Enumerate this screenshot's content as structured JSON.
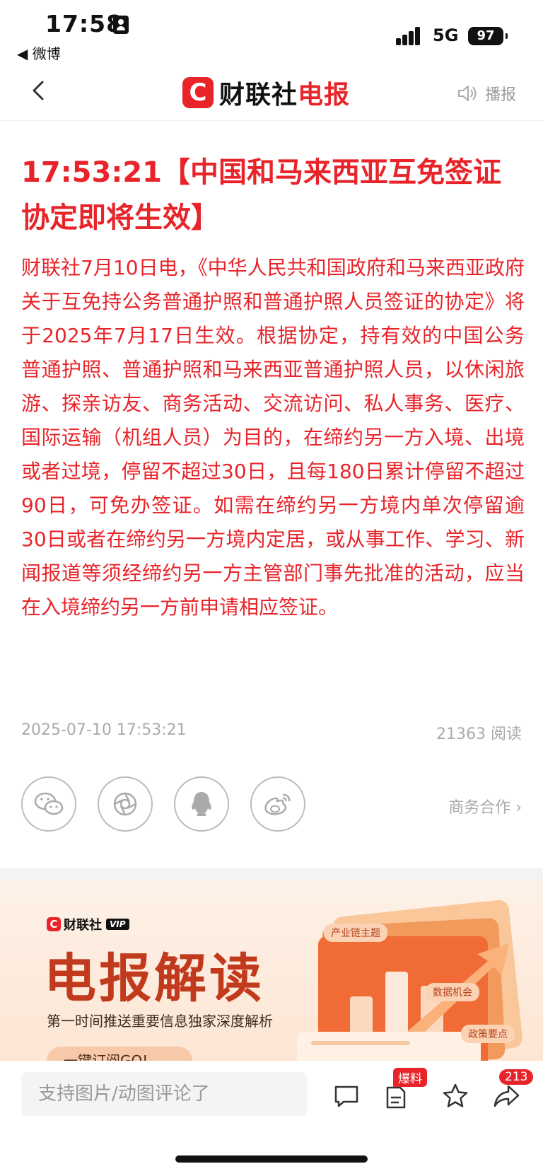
{
  "status_bar": {
    "time": "17:58",
    "back_app": "◀ 微博",
    "network": "5G",
    "battery": "97"
  },
  "nav": {
    "logo_mark": "C",
    "logo_brand": "财联社",
    "logo_product": "电报",
    "broadcast_label": "播报"
  },
  "article": {
    "headline": "17:53:21【中国和马来西亚互免签证协定即将生效】",
    "body": "财联社7月10日电，《中华人民共和国政府和马来西亚政府关于互免持公务普通护照和普通护照人员签证的协定》将于2025年7月17日生效。根据协定，持有效的中国公务普通护照、普通护照和马来西亚普通护照人员，以休闲旅游、探亲访友、商务活动、交流访问、私人事务、医疗、国际运输（机组人员）为目的，在缔约另一方入境、出境或者过境，停留不超过30日，且每180日累计停留不超过90日，可免办签证。如需在缔约另一方境内单次停留逾30日或者在缔约另一方境内定居，或从事工作、学习、新闻报道等须经缔约另一方主管部门事先批准的活动，应当在入境缔约另一方前申请相应签证。",
    "datetime": "2025-07-10 17:53:21",
    "reads": "21363 阅读"
  },
  "share": {
    "icons": [
      "wechat-icon",
      "moments-icon",
      "qq-icon",
      "weibo-icon"
    ],
    "business_link": "商务合作 ›"
  },
  "banner": {
    "vip_logo_mark": "C",
    "vip_brand": "财联社",
    "vip_tag": "VIP",
    "title": "电报解读",
    "subtitle": "第一时间推送重要信息独家深度解析",
    "button": "一键订阅GO!",
    "chips": [
      "产业链主题",
      "数据机会",
      "政策要点"
    ]
  },
  "bottom_bar": {
    "comment_placeholder": "支持图片/动图评论了",
    "report_badge": "爆料",
    "share_count": "213"
  },
  "colors": {
    "accent": "#e8242a",
    "muted": "#aaaaaa"
  }
}
